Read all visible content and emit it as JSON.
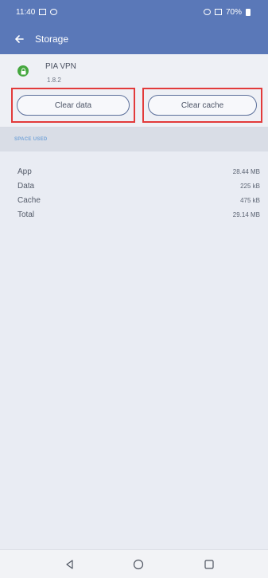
{
  "status_bar": {
    "time": "11:40",
    "battery_percent": "70%"
  },
  "header": {
    "title": "Storage"
  },
  "app": {
    "name": "PIA VPN",
    "version": "1.8.2"
  },
  "actions": {
    "clear_data_label": "Clear data",
    "clear_cache_label": "Clear cache"
  },
  "section": {
    "title": "SPACE USED"
  },
  "storage_rows": [
    {
      "label": "App",
      "value": "28.44 MB"
    },
    {
      "label": "Data",
      "value": "225 kB"
    },
    {
      "label": "Cache",
      "value": "475 kB"
    },
    {
      "label": "Total",
      "value": "29.14 MB"
    }
  ],
  "icons": {
    "back": "back-arrow-icon",
    "app": "lock-icon",
    "nav_back": "triangle-back-icon",
    "nav_home": "circle-home-icon",
    "nav_recents": "square-recents-icon"
  },
  "colors": {
    "app_bar": "#5a78b8",
    "highlight": "#e23a3a",
    "section_text": "#7aa7d9",
    "app_icon": "#45a73f",
    "background": "#e9ecf3"
  }
}
